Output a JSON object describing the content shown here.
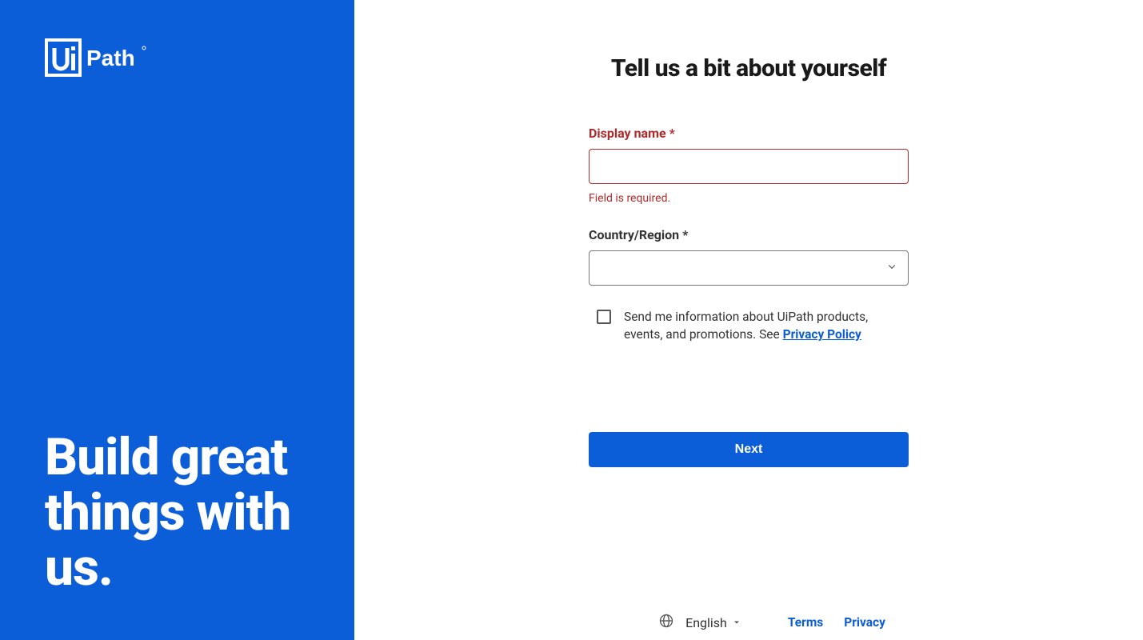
{
  "sidebar": {
    "tagline": "Build great things with us."
  },
  "form": {
    "heading": "Tell us a bit about yourself",
    "display_name": {
      "label": "Display name *",
      "value": "",
      "error": "Field is required."
    },
    "country": {
      "label": "Country/Region *",
      "value": ""
    },
    "marketing_consent": {
      "checked": false,
      "text": "Send me information about UiPath products, events, and promotions. See ",
      "link_text": "Privacy Policy"
    },
    "next_label": "Next"
  },
  "footer": {
    "language": "English",
    "terms": "Terms",
    "privacy": "Privacy"
  }
}
